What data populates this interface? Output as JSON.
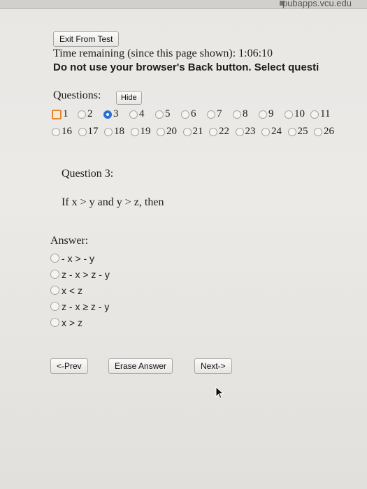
{
  "browser": {
    "url": "pubapps.vcu.edu"
  },
  "header": {
    "exit_label": "Exit From Test",
    "time_text": "Time remaining (since this page shown):  1:06:10",
    "warning_text": "Do not use your browser's Back button. Select questi"
  },
  "questions_nav": {
    "label": "Questions:",
    "hide_label": "Hide",
    "row1": [
      {
        "n": "1",
        "state": "current"
      },
      {
        "n": "2",
        "state": "unanswered"
      },
      {
        "n": "3",
        "state": "selected"
      },
      {
        "n": "4",
        "state": "unanswered"
      },
      {
        "n": "5",
        "state": "unanswered"
      },
      {
        "n": "6",
        "state": "unanswered"
      },
      {
        "n": "7",
        "state": "unanswered"
      },
      {
        "n": "8",
        "state": "unanswered"
      },
      {
        "n": "9",
        "state": "unanswered"
      },
      {
        "n": "10",
        "state": "unanswered"
      },
      {
        "n": "11",
        "state": "unanswered"
      }
    ],
    "row2": [
      {
        "n": "16",
        "state": "unanswered"
      },
      {
        "n": "17",
        "state": "unanswered"
      },
      {
        "n": "18",
        "state": "unanswered"
      },
      {
        "n": "19",
        "state": "unanswered"
      },
      {
        "n": "20",
        "state": "unanswered"
      },
      {
        "n": "21",
        "state": "unanswered"
      },
      {
        "n": "22",
        "state": "unanswered"
      },
      {
        "n": "23",
        "state": "unanswered"
      },
      {
        "n": "24",
        "state": "unanswered"
      },
      {
        "n": "25",
        "state": "unanswered"
      },
      {
        "n": "26",
        "state": "unanswered"
      }
    ]
  },
  "question": {
    "title": "Question 3:",
    "text": "If x > y and y > z, then"
  },
  "answer": {
    "label": "Answer:",
    "options": [
      "- x > - y",
      "z - x > z - y",
      "x < z",
      "z - x ≥ z - y",
      "x > z"
    ]
  },
  "footer": {
    "prev_label": "<-Prev",
    "erase_label": "Erase Answer",
    "next_label": "Next->"
  },
  "colors": {
    "selected": "#2a6fd6",
    "current": "#e0892f"
  }
}
